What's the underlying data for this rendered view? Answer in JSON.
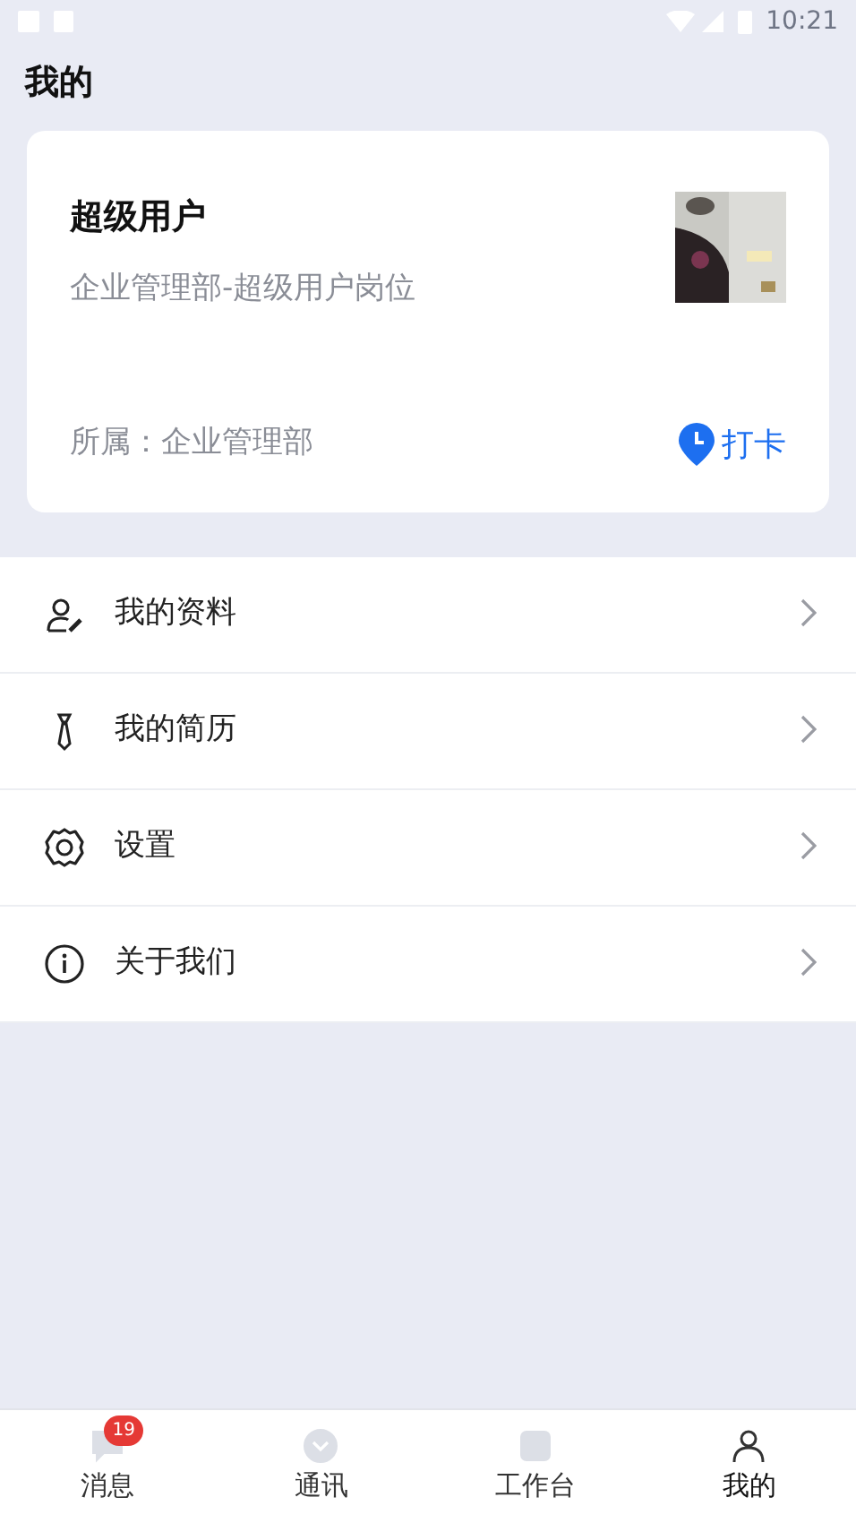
{
  "status_bar": {
    "time": "10:21"
  },
  "title": "我的",
  "profile": {
    "name": "超级用户",
    "position": "企业管理部-超级用户岗位",
    "department": "所属：企业管理部",
    "check_in": "打卡"
  },
  "menu": [
    {
      "kind": "profile",
      "label": "我的资料"
    },
    {
      "kind": "resume",
      "label": "我的简历"
    },
    {
      "kind": "settings",
      "label": "设置"
    },
    {
      "kind": "about",
      "label": "关于我们"
    }
  ],
  "tabs": [
    {
      "kind": "messages",
      "label": "消息",
      "badge": "19",
      "selected": false
    },
    {
      "kind": "contacts",
      "label": "通讯",
      "selected": false
    },
    {
      "kind": "work",
      "label": "工作台",
      "selected": false
    },
    {
      "kind": "me",
      "label": "我的",
      "selected": true
    }
  ]
}
